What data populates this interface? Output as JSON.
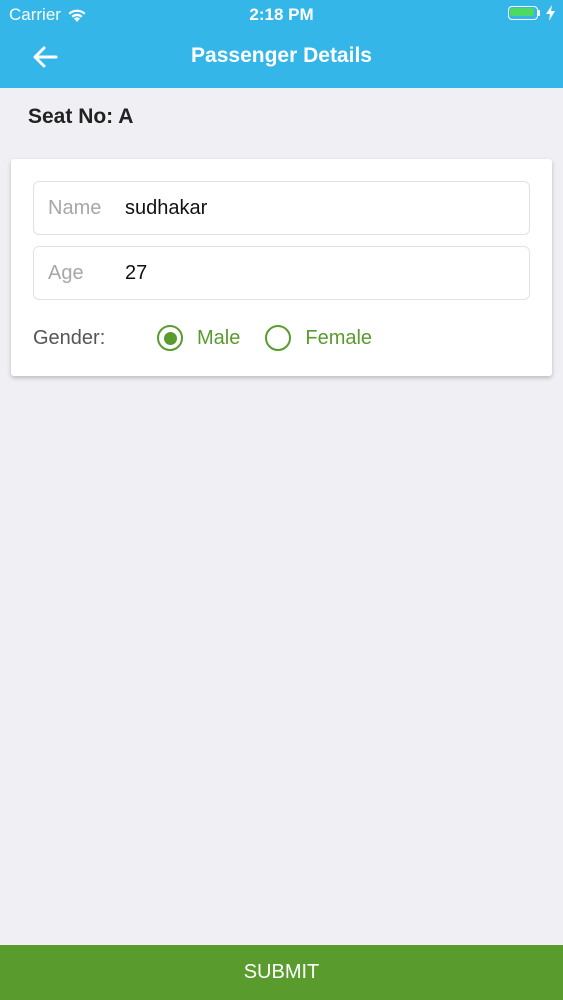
{
  "status_bar": {
    "carrier": "Carrier",
    "time": "2:18 PM",
    "icons": [
      "wifi-icon",
      "battery-icon",
      "charging-bolt-icon"
    ],
    "battery_color": "#4cd964"
  },
  "nav": {
    "title": "Passenger Details",
    "back_icon": "arrow-left-icon",
    "background": "#35b6e8"
  },
  "seat": {
    "label": "Seat No: A"
  },
  "form": {
    "name": {
      "label": "Name",
      "value": "sudhakar"
    },
    "age": {
      "label": "Age",
      "value": "27"
    },
    "gender": {
      "label": "Gender:",
      "options": [
        {
          "label": "Male",
          "selected": true
        },
        {
          "label": "Female",
          "selected": false
        }
      ],
      "accent": "#5a9b2e"
    }
  },
  "submit": {
    "label": "SUBMIT",
    "background": "#5a9b2e"
  }
}
